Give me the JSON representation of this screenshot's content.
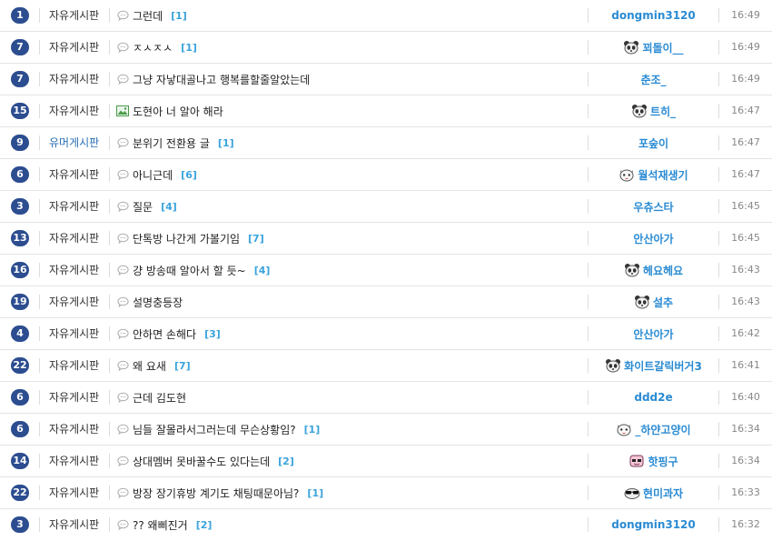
{
  "colors": {
    "badge": "#2c4d8f",
    "author": "#2a8bd3",
    "comment_count": "#3aa3dc",
    "humor_category": "#2a6fb5"
  },
  "posts": [
    {
      "num": "1",
      "category": "자유게시판",
      "icon": "speech-bubble-icon",
      "title": "그런데",
      "comments": "[1]",
      "author": "dongmin3120",
      "avatar": "",
      "time": "16:49"
    },
    {
      "num": "7",
      "category": "자유게시판",
      "icon": "speech-bubble-icon",
      "title": "ㅈㅅㅈㅅ",
      "comments": "[1]",
      "author": "꾀돌이__",
      "avatar": "panda",
      "time": "16:49"
    },
    {
      "num": "7",
      "category": "자유게시판",
      "icon": "speech-bubble-icon",
      "title": "그냥 자낳대골나고 행복를할줄알았는데",
      "comments": "",
      "author": "춘조_",
      "avatar": "",
      "time": "16:49"
    },
    {
      "num": "15",
      "category": "자유게시판",
      "icon": "image-icon",
      "title": "도현아 너 알아 해라",
      "comments": "",
      "author": "트히_",
      "avatar": "panda",
      "time": "16:47"
    },
    {
      "num": "9",
      "category": "유머게시판",
      "icon": "speech-bubble-icon",
      "title": "분위기 전환용 글",
      "comments": "[1]",
      "author": "포숲이",
      "avatar": "",
      "time": "16:47"
    },
    {
      "num": "6",
      "category": "자유게시판",
      "icon": "speech-bubble-icon",
      "title": "아니근데",
      "comments": "[6]",
      "author": "월석재생기",
      "avatar": "cat",
      "time": "16:47"
    },
    {
      "num": "3",
      "category": "자유게시판",
      "icon": "speech-bubble-icon",
      "title": "질문",
      "comments": "[4]",
      "author": "우츄스타",
      "avatar": "",
      "time": "16:45"
    },
    {
      "num": "13",
      "category": "자유게시판",
      "icon": "speech-bubble-icon",
      "title": "단톡방 나간게 가볼기임",
      "comments": "[7]",
      "author": "안산아가",
      "avatar": "",
      "time": "16:45"
    },
    {
      "num": "16",
      "category": "자유게시판",
      "icon": "speech-bubble-icon",
      "title": "걍 방송때 알아서 할 듯~",
      "comments": "[4]",
      "author": "헤요헤요",
      "avatar": "panda",
      "time": "16:43"
    },
    {
      "num": "19",
      "category": "자유게시판",
      "icon": "speech-bubble-icon",
      "title": "설명충등장",
      "comments": "",
      "author": "설추",
      "avatar": "panda",
      "time": "16:43"
    },
    {
      "num": "4",
      "category": "자유게시판",
      "icon": "speech-bubble-icon",
      "title": "안하면 손해다",
      "comments": "[3]",
      "author": "안산아가",
      "avatar": "",
      "time": "16:42"
    },
    {
      "num": "22",
      "category": "자유게시판",
      "icon": "speech-bubble-icon",
      "title": "왜 요새",
      "comments": "[7]",
      "author": "화이트갈릭버거3",
      "avatar": "panda",
      "time": "16:41"
    },
    {
      "num": "6",
      "category": "자유게시판",
      "icon": "speech-bubble-icon",
      "title": "근데 김도현",
      "comments": "",
      "author": "ddd2e",
      "avatar": "",
      "time": "16:40"
    },
    {
      "num": "6",
      "category": "자유게시판",
      "icon": "speech-bubble-icon",
      "title": "님들 잘몰라서그러는데 무슨상황임?",
      "comments": "[1]",
      "author": "_하얀고양이",
      "avatar": "cat",
      "time": "16:34"
    },
    {
      "num": "14",
      "category": "자유게시판",
      "icon": "speech-bubble-icon",
      "title": "상대멤버 못바꿀수도 있다는데",
      "comments": "[2]",
      "author": "핫핑구",
      "avatar": "pink",
      "time": "16:34"
    },
    {
      "num": "22",
      "category": "자유게시판",
      "icon": "speech-bubble-icon",
      "title": "방장 장기휴방 계기도 채팅때문아님?",
      "comments": "[1]",
      "author": "현미과자",
      "avatar": "sunglasses",
      "time": "16:33"
    },
    {
      "num": "3",
      "category": "자유게시판",
      "icon": "speech-bubble-icon",
      "title": "?? 왜삐진거",
      "comments": "[2]",
      "author": "dongmin3120",
      "avatar": "",
      "time": "16:32"
    }
  ]
}
